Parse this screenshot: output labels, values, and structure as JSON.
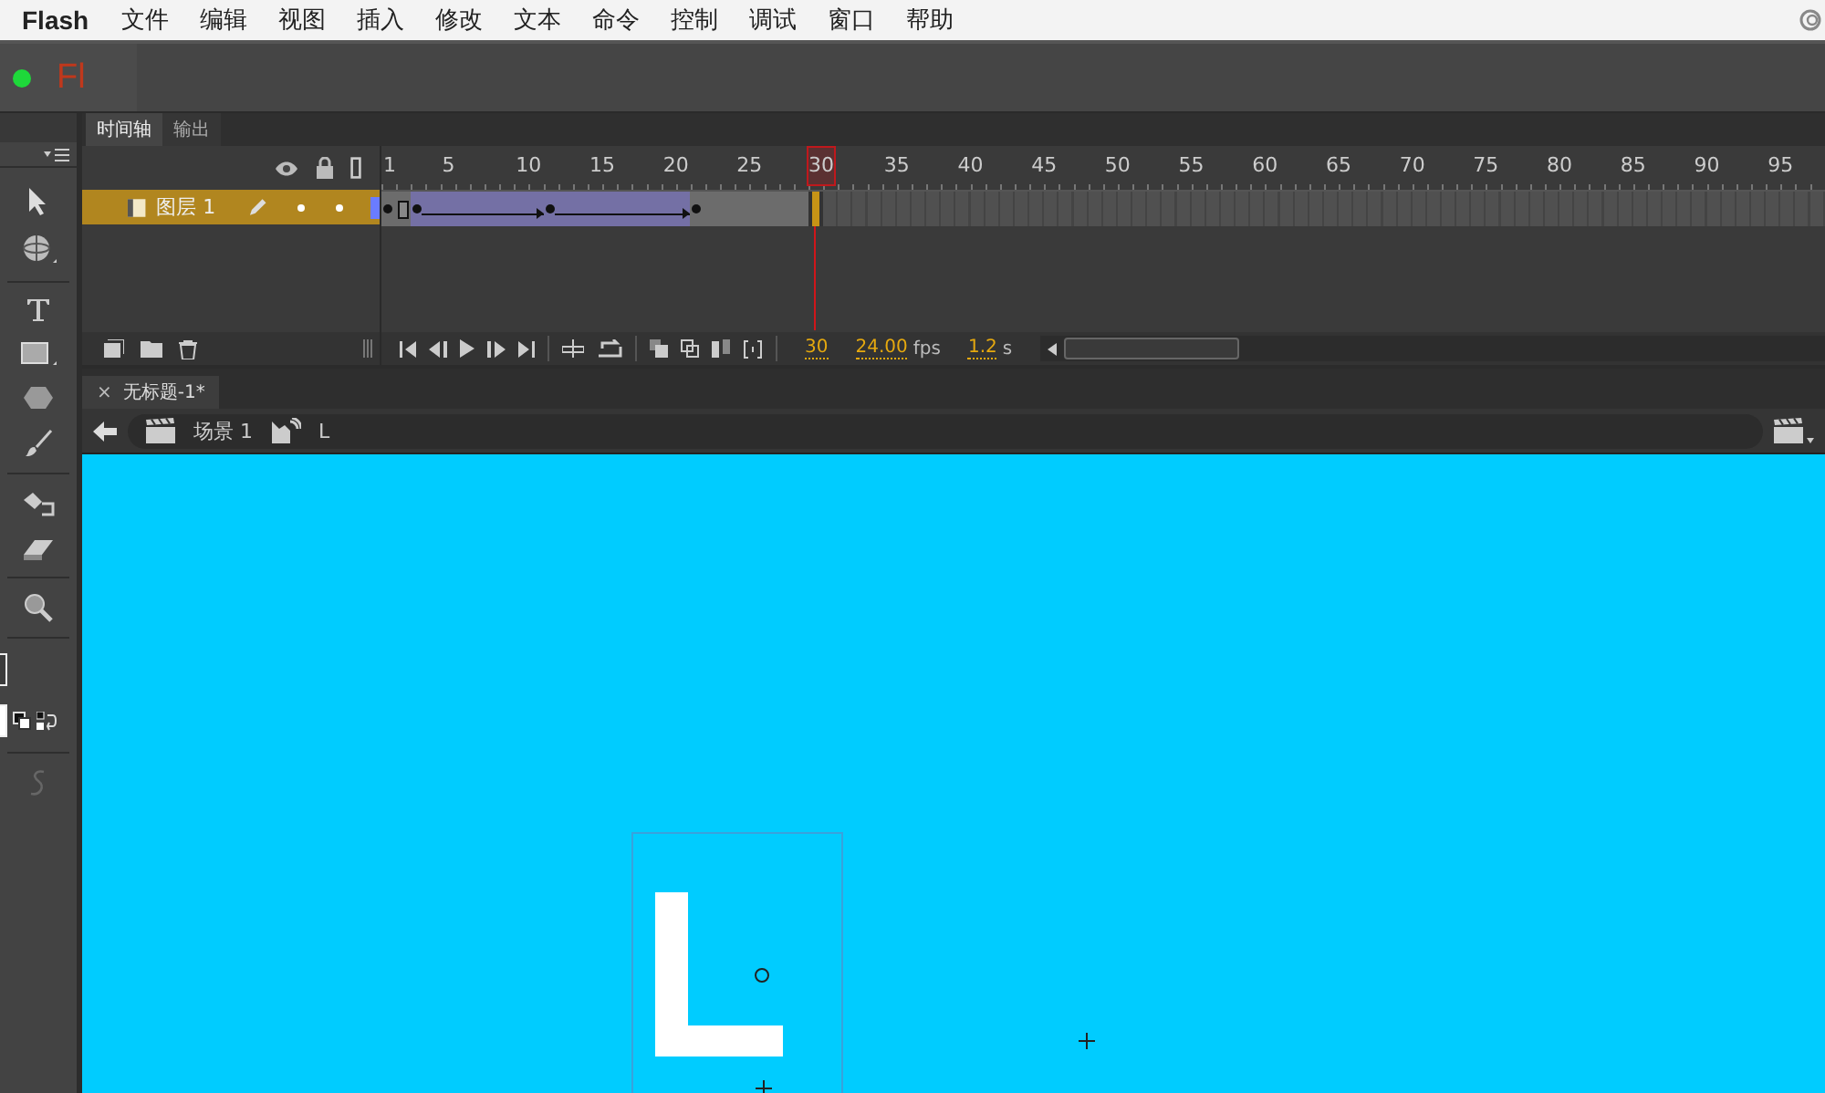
{
  "menu_bar": {
    "app_name": "Flash",
    "items": [
      "文件",
      "编辑",
      "视图",
      "插入",
      "修改",
      "文本",
      "命令",
      "控制",
      "调试",
      "窗口",
      "帮助"
    ]
  },
  "app_bar": {
    "logo": "Fl"
  },
  "timeline": {
    "tabs": [
      {
        "label": "时间轴",
        "selected": true
      },
      {
        "label": "输出",
        "selected": false
      }
    ],
    "ruler": [
      "1",
      "5",
      "10",
      "15",
      "20",
      "25",
      "30",
      "35",
      "40",
      "45",
      "50",
      "55",
      "60",
      "65",
      "70",
      "75",
      "80",
      "85",
      "90",
      "95"
    ],
    "layers": [
      {
        "name": "图层 1",
        "selected": true
      }
    ],
    "frames": [
      {
        "kind": "key",
        "selected": false
      },
      {
        "kind": "end",
        "selected": false
      },
      {
        "kind": "tween_key",
        "selected": false
      },
      {
        "kind": "tween",
        "selected": false
      },
      {
        "kind": "tween",
        "selected": false
      },
      {
        "kind": "tween",
        "selected": false
      },
      {
        "kind": "tween",
        "selected": false
      },
      {
        "kind": "tween",
        "selected": false
      },
      {
        "kind": "tween",
        "selected": false
      },
      {
        "kind": "tween",
        "selected": false
      },
      {
        "kind": "tween_last",
        "selected": false
      },
      {
        "kind": "tween_key",
        "selected": false
      },
      {
        "kind": "tween",
        "selected": false
      },
      {
        "kind": "tween",
        "selected": false
      },
      {
        "kind": "tween",
        "selected": false
      },
      {
        "kind": "tween",
        "selected": false
      },
      {
        "kind": "tween",
        "selected": false
      },
      {
        "kind": "tween",
        "selected": false
      },
      {
        "kind": "tween",
        "selected": false
      },
      {
        "kind": "tween",
        "selected": false
      },
      {
        "kind": "tween_last",
        "selected": false
      },
      {
        "kind": "key",
        "selected": false
      },
      {
        "kind": "static",
        "selected": false
      },
      {
        "kind": "static",
        "selected": false
      },
      {
        "kind": "static",
        "selected": false
      },
      {
        "kind": "static",
        "selected": false
      },
      {
        "kind": "static",
        "selected": false
      },
      {
        "kind": "static",
        "selected": false
      },
      {
        "kind": "static",
        "selected": false
      },
      {
        "kind": "empty",
        "selected": true
      }
    ],
    "status": {
      "frame": "30",
      "fps": "24.00",
      "fps_unit": "fps",
      "time": "1.2",
      "time_unit": "s"
    }
  },
  "document_tab": {
    "close": "×",
    "title": "无标题-1*"
  },
  "edit_bar": {
    "scene": "场景 1",
    "symbol": "L"
  }
}
